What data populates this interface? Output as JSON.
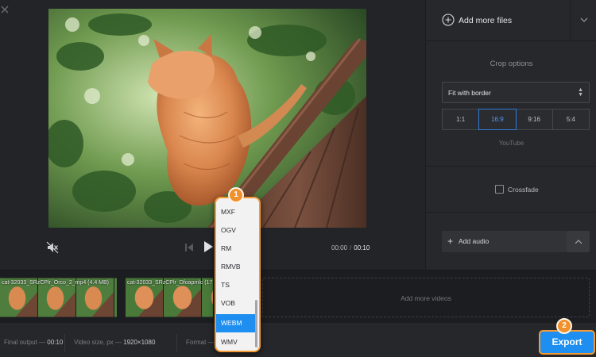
{
  "player": {
    "current_time": "00:00",
    "time_separator": "/",
    "duration": "00:10"
  },
  "panel": {
    "add_files_label": "Add more files",
    "crop_title": "Crop options",
    "crop_mode": "Fit with border",
    "ratios": [
      {
        "label": "1:1",
        "active": false
      },
      {
        "label": "16:9",
        "active": true
      },
      {
        "label": "9:16",
        "active": false
      },
      {
        "label": "5:4",
        "active": false
      }
    ],
    "ratio_caption": "YouTube",
    "crossfade_label": "Crossfade",
    "add_audio_label": "Add audio"
  },
  "timeline": {
    "clips": [
      {
        "name": "cat-32033_SRzCPlr_Orco_2_mp4 (4.4 MB)"
      },
      {
        "name": "cat-32033_SRzCPlr_Dfoapmlc (17"
      }
    ],
    "add_videos_label": "Add more videos"
  },
  "status": {
    "final_output_label": "Final output —",
    "final_output_value": "00:10",
    "video_size_label": "Video size, px —",
    "video_size_value": "1920×1080",
    "format_label": "Format —"
  },
  "format_dropdown": {
    "options": [
      "MXF",
      "OGV",
      "RM",
      "RMVB",
      "TS",
      "VOB",
      "WEBM",
      "WMV"
    ],
    "selected": "WEBM"
  },
  "export_label": "Export",
  "callouts": {
    "step_1": "1",
    "step_2": "2"
  },
  "colors": {
    "accent": "#1e8ef0",
    "highlight": "#f39a33",
    "badge": "#f0912c",
    "background": "#222327"
  },
  "icons": [
    "close-icon",
    "mute-icon",
    "previous-icon",
    "play-icon",
    "add-circle-icon",
    "chevron-down-icon",
    "chevron-up-icon",
    "plus-icon",
    "sort-arrows-icon"
  ]
}
